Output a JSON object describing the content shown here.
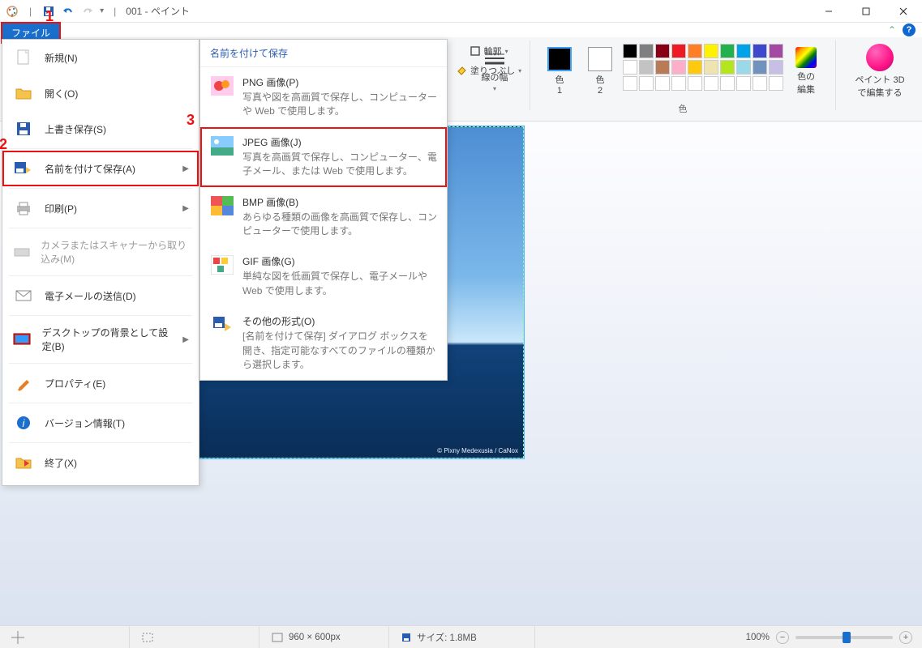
{
  "window": {
    "title": "001 - ペイント",
    "separator": "|"
  },
  "annotations": {
    "a1": "1",
    "a2": "2",
    "a3": "3"
  },
  "file_tab": "ファイル",
  "file_menu": {
    "new_": "新規(N)",
    "open": "開く(O)",
    "save": "上書き保存(S)",
    "save_as": "名前を付けて保存(A)",
    "print": "印刷(P)",
    "scanner": "カメラまたはスキャナーから取り込み(M)",
    "email": "電子メールの送信(D)",
    "wallpaper": "デスクトップの背景として設定(B)",
    "properties": "プロパティ(E)",
    "about": "バージョン情報(T)",
    "exit": "終了(X)"
  },
  "saveas": {
    "header": "名前を付けて保存",
    "png": {
      "title": "PNG 画像(P)",
      "desc": "写真や図を高画質で保存し、コンピューターや Web で使用します。"
    },
    "jpeg": {
      "title": "JPEG 画像(J)",
      "desc": "写真を高画質で保存し、コンピューター、電子メール、または Web で使用します。"
    },
    "bmp": {
      "title": "BMP 画像(B)",
      "desc": "あらゆる種類の画像を高画質で保存し、コンピューターで使用します。"
    },
    "gif": {
      "title": "GIF 画像(G)",
      "desc": "単純な図を低画質で保存し、電子メールや Web で使用します。"
    },
    "other": {
      "title": "その他の形式(O)",
      "desc": "[名前を付けて保存] ダイアログ ボックスを開き、指定可能なすべてのファイルの種類から選択します。"
    }
  },
  "ribbon": {
    "outline": "輪郭",
    "fill": "塗りつぶし",
    "line_width": "線の幅",
    "color1": "色\n1",
    "color2": "色\n2",
    "edit_colors": "色の\n編集",
    "paint3d": "ペイント 3D\nで編集する",
    "colors_label": "色",
    "palette": [
      "#000000",
      "#7f7f7f",
      "#880015",
      "#ed1c24",
      "#ff7f27",
      "#fff200",
      "#22b14c",
      "#00a2e8",
      "#3f48cc",
      "#a349a4",
      "#ffffff",
      "#c3c3c3",
      "#b97a57",
      "#ffaec9",
      "#ffc90e",
      "#efe4b0",
      "#b5e61d",
      "#99d9ea",
      "#7092be",
      "#c8bfe7"
    ]
  },
  "canvas": {
    "credit": "© Pixny Medexusia / CaNox"
  },
  "status": {
    "dimensions": "960 × 600px",
    "size": "サイズ: 1.8MB",
    "zoom": "100%"
  }
}
